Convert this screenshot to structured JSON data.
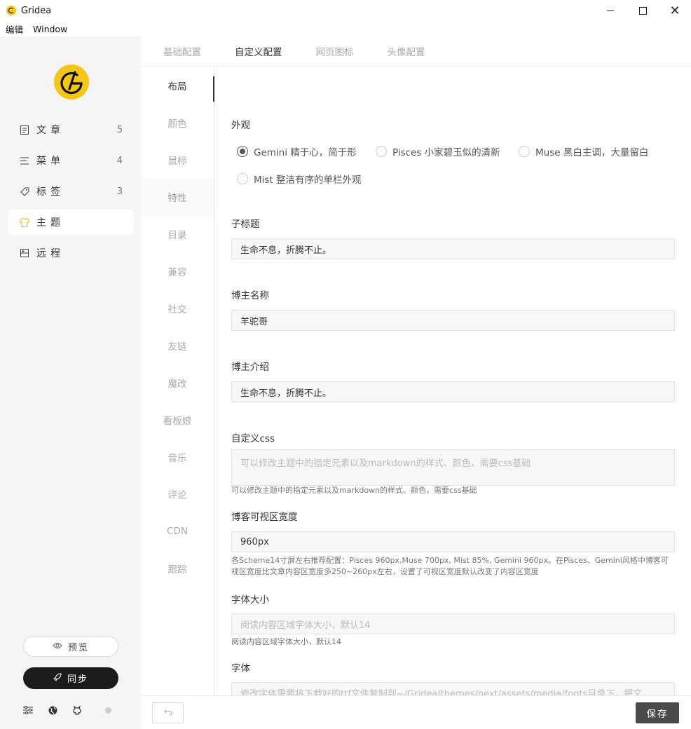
{
  "window": {
    "title": "Gridea"
  },
  "menu": {
    "items": [
      "编辑",
      "Window"
    ]
  },
  "sidebar": {
    "items": [
      {
        "label": "文章",
        "count": "5",
        "icon": "document-icon"
      },
      {
        "label": "菜单",
        "count": "4",
        "icon": "menu-icon"
      },
      {
        "label": "标签",
        "count": "3",
        "icon": "tag-icon"
      },
      {
        "label": "主题",
        "count": "",
        "icon": "shirt-icon"
      },
      {
        "label": "远程",
        "count": "",
        "icon": "remote-icon"
      }
    ],
    "active": "主题",
    "preview_label": "预览",
    "sync_label": "同步"
  },
  "tabs": [
    {
      "label": "基础配置",
      "active": false
    },
    {
      "label": "自定义配置",
      "active": true
    },
    {
      "label": "网页图标",
      "active": false
    },
    {
      "label": "头像配置",
      "active": false
    }
  ],
  "subnav": [
    "布局",
    "颜色",
    "鼠标",
    "特性",
    "目录",
    "兼容",
    "社交",
    "友链",
    "魔改",
    "看板娘",
    "音乐",
    "评论",
    "CDN",
    "跟踪"
  ],
  "form": {
    "appearance": {
      "label": "外观",
      "options": [
        "Gemini 精于心，简于形",
        "Pisces 小家碧玉似的清新",
        "Muse 黑白主调，大量留白",
        "Mist 整洁有序的单栏外观"
      ],
      "selected": "Gemini 精于心，简于形"
    },
    "subtitle": {
      "label": "子标题",
      "value": "生命不息，折腾不止。"
    },
    "author_name": {
      "label": "博主名称",
      "value": "羊驼哥"
    },
    "author_intro": {
      "label": "博主介绍",
      "value": "生命不息，折腾不止。"
    },
    "custom_css": {
      "label": "自定义css",
      "placeholder": "可以修改主题中的指定元素以及markdown的样式、颜色，需要css基础",
      "hint": "可以修改主题中的指定元素以及markdown的样式、颜色，需要css基础"
    },
    "view_width": {
      "label": "博客可视区宽度",
      "value": "960px",
      "hint": "各Scheme14寸屏左右推荐配置：Pisces 960px,Muse 700px, Mist 85%, Gemini 960px。在Pisces、Gemini风格中博客可视区宽度比文章内容区宽度多250~260px左右，设置了可视区宽度默认改变了内容区宽度"
    },
    "font_size": {
      "label": "字体大小",
      "placeholder": "阅读内容区域字体大小，默认14",
      "hint": "阅读内容区域字体大小，默认14"
    },
    "font": {
      "label": "字体",
      "placeholder": "修改字体需要将下载好的ttf文件复制到~/Gridea/themes/next/assets/media/fonts目录下，把文"
    }
  },
  "footer": {
    "save_label": "保存"
  }
}
